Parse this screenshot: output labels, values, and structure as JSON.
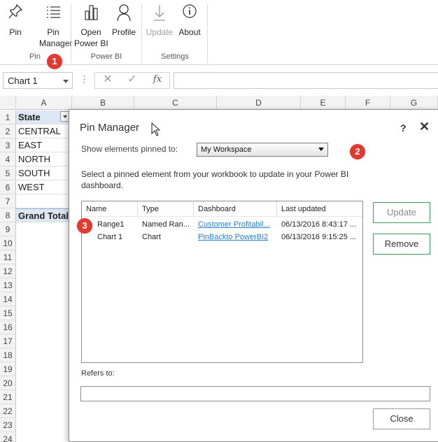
{
  "ribbon": {
    "groups": {
      "pin": "Pin",
      "powerbi": "Power BI",
      "settings": "Settings"
    },
    "buttons": {
      "pin": [
        "Pin"
      ],
      "pin_manager": [
        "Pin",
        "Manager"
      ],
      "open_powerbi": [
        "Open",
        "Power BI"
      ],
      "profile": [
        "Profile"
      ],
      "update": [
        "Update"
      ],
      "about": [
        "About"
      ]
    }
  },
  "callouts": {
    "one": "1",
    "two": "2",
    "three": "3"
  },
  "formula_bar": {
    "name_box": "Chart 1",
    "dots": "⋮",
    "cancel": "✕",
    "enter": "✓",
    "fx": "fx"
  },
  "grid": {
    "columns": [
      "A",
      "B",
      "C",
      "D",
      "E",
      "F",
      "G"
    ],
    "rows": [
      "1",
      "2",
      "3",
      "4",
      "5",
      "6",
      "7",
      "8",
      "9",
      "10",
      "11",
      "12",
      "13",
      "14",
      "15",
      "16",
      "17",
      "18",
      "19",
      "20",
      "21",
      "22",
      "23",
      "24"
    ],
    "cells": {
      "a1": "State",
      "a2": "CENTRAL",
      "a3": "EAST",
      "a4": "NORTH",
      "a5": "SOUTH",
      "a6": "WEST",
      "a8": "Grand Total"
    }
  },
  "dialog": {
    "title": "Pin Manager",
    "help": "?",
    "close_x": "✕",
    "show_label": "Show elements pinned to:",
    "workspace": "My Workspace",
    "description": "Select a pinned element from your workbook to update in your Power BI dashboard.",
    "list": {
      "headers": [
        "Name",
        "Type",
        "Dashboard",
        "Last updated"
      ],
      "rows": [
        {
          "name": "Range1",
          "type": "Named Ran...",
          "dashboard": "Customer Profitabil...",
          "updated": "06/13/2016 8:43:17 ..."
        },
        {
          "name": "Chart 1",
          "type": "Chart",
          "dashboard": "PinBackto PowerBI2",
          "updated": "06/13/2016 9:15:25 ..."
        }
      ]
    },
    "update_label": "Update",
    "remove_label": "Remove",
    "refers_to_label": "Refers to:",
    "close_label": "Close"
  },
  "colors": {
    "accent_green": "#3c9b63",
    "callout_red": "#e23a2e",
    "link_blue": "#1f7fd0"
  }
}
